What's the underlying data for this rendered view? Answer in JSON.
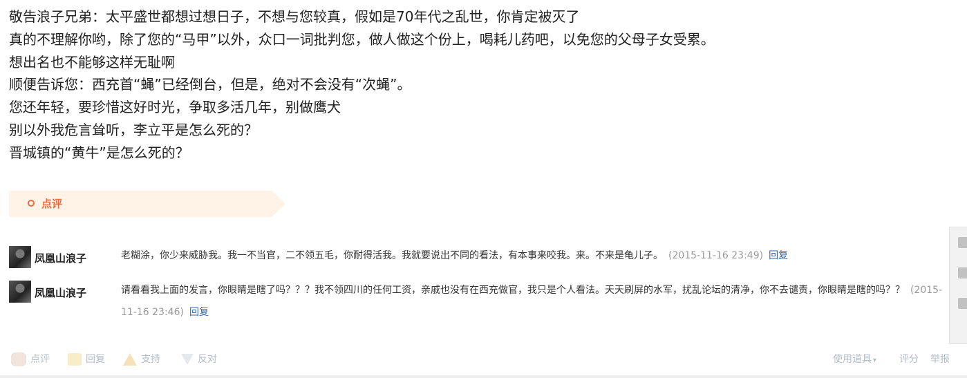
{
  "post": {
    "lines": [
      "敬告浪子兄弟：太平盛世都想过想日子，不想与您较真，假如是70年代之乱世，你肯定被灭了",
      "真的不理解你哟，除了您的“马甲”以外，众口一词批判您，做人做这个份上，喝耗儿药吧，以免您的父母子女受累。",
      "想出名也不能够这样无耻啊",
      "顺便告诉您：西充首“蝇”已经倒台，但是，绝对不会没有“次蝇”。",
      "您还年轻，要珍惜这好时光，争取多活几年，别做鹰犬",
      "别以外我危言耸听，李立平是怎么死的？",
      "晋城镇的“黄牛”是怎么死的？"
    ]
  },
  "dianping": {
    "title": "点评"
  },
  "comments": [
    {
      "user": "凤凰山浪子",
      "text": "老糊涂，你少来威胁我。我一不当官，二不领五毛，你耐得活我。我就要说出不同的看法，有本事来咬我。来。不来是龟儿子。",
      "time": "(2015-11-16 23:49)",
      "reply": "回复"
    },
    {
      "user": "凤凰山浪子",
      "text": "请看看我上面的发言，你眼睛是瞎了吗？？？我不领四川的任何工资，亲戚也没有在西充做官，我只是个人看法。天天刷屏的水军，扰乱论坛的清净，你不去谴责，你眼睛是瞎的吗？？",
      "time": "(2015-11-16 23:46)",
      "reply": "回复"
    }
  ],
  "actions": {
    "dianping": "点评",
    "reply": "回复",
    "support": "支持",
    "oppose": "反对",
    "tools": "使用道具",
    "rate": "评分",
    "report": "举报"
  },
  "icons": [
    "dianping-icon",
    "reply-icon",
    "thumb-up-icon",
    "thumb-down-icon",
    "dropdown-caret-icon",
    "qrcode-icon",
    "share-icon",
    "favorite-icon"
  ],
  "colors": {
    "accent": "#f26d3d",
    "link": "#3366aa",
    "muted": "#999999",
    "banner_bg": "#fff2e6"
  }
}
